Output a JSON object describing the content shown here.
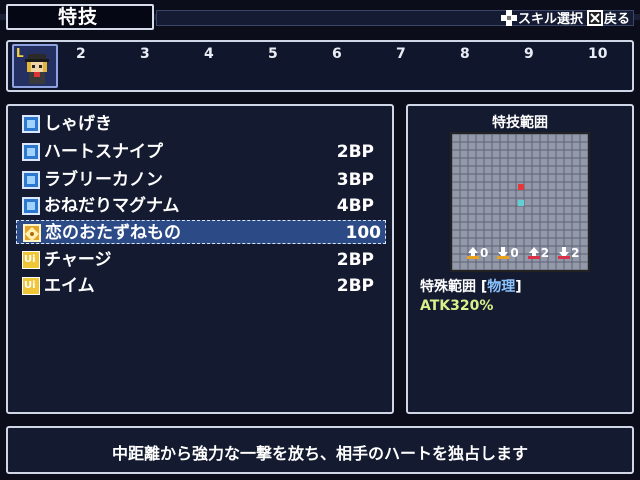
{
  "header": {
    "title": "特技",
    "hint_select_label": "スキル選択",
    "hint_back_label": "戻る"
  },
  "party": {
    "slot_letter": "L",
    "slot_numbers": [
      "2",
      "3",
      "4",
      "5",
      "6",
      "7",
      "8",
      "9",
      "10"
    ]
  },
  "skills": [
    {
      "name": "しゃげき",
      "cost": "",
      "icon": "blue-square-icon"
    },
    {
      "name": "ハートスナイプ",
      "cost": "2BP",
      "icon": "blue-square-icon"
    },
    {
      "name": "ラブリーカノン",
      "cost": "3BP",
      "icon": "blue-square-icon"
    },
    {
      "name": "おねだりマグナム",
      "cost": "4BP",
      "icon": "blue-square-icon"
    },
    {
      "name": "恋のおたずねもの",
      "cost": "100",
      "icon": "gold-pattern-icon",
      "selected": true
    },
    {
      "name": "チャージ",
      "cost": "2BP",
      "icon": "ui-badge-icon",
      "icon_text": "Ui"
    },
    {
      "name": "エイム",
      "cost": "2BP",
      "icon": "ui-badge-icon",
      "icon_text": "Ui"
    }
  ],
  "range": {
    "title": "特技範囲",
    "stats": [
      "0",
      "0",
      "2",
      "2"
    ],
    "label_prefix": "特殊範囲 [",
    "type": "物理",
    "label_suffix": "]",
    "atk": "ATK320%"
  },
  "description": "中距離から強力な一撃を放ち、相手のハートを独占します",
  "colors": {
    "background": "#0b0d1a",
    "panel": "#141a30",
    "border": "#cfd6e6",
    "selected_row": "#2b4a86",
    "target_cell": "#e23a3a",
    "origin_cell": "#5fd0d6",
    "type_text": "#8cc4ff",
    "atk_text": "#d9f08a"
  }
}
